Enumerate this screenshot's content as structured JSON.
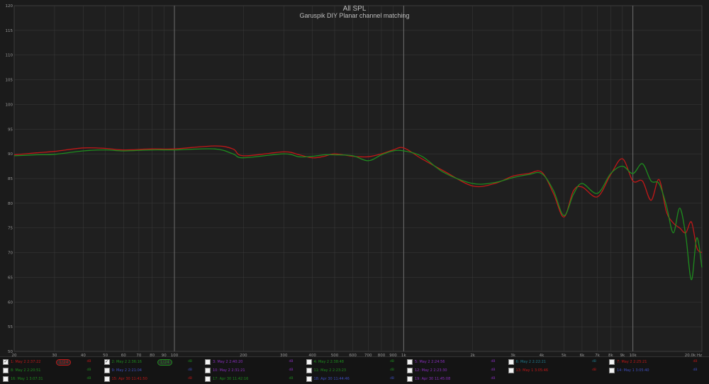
{
  "chart_data": {
    "type": "line",
    "title": "All SPL",
    "subtitle": "Garuspik DIY Planar channel matching",
    "xscale": "log",
    "xlim": [
      20,
      20000
    ],
    "ylim": [
      50,
      120
    ],
    "grid": true,
    "x_ticks": [
      {
        "v": 20,
        "t": "20"
      },
      {
        "v": 30,
        "t": "30"
      },
      {
        "v": 40,
        "t": "40"
      },
      {
        "v": 50,
        "t": "50"
      },
      {
        "v": 60,
        "t": "60"
      },
      {
        "v": 70,
        "t": "70"
      },
      {
        "v": 80,
        "t": "80"
      },
      {
        "v": 90,
        "t": "90"
      },
      {
        "v": 100,
        "t": "100"
      },
      {
        "v": 200,
        "t": "200"
      },
      {
        "v": 300,
        "t": "300"
      },
      {
        "v": 400,
        "t": "400"
      },
      {
        "v": 500,
        "t": "500"
      },
      {
        "v": 600,
        "t": "600"
      },
      {
        "v": 700,
        "t": "700"
      },
      {
        "v": 800,
        "t": "800"
      },
      {
        "v": 900,
        "t": "900"
      },
      {
        "v": 1000,
        "t": "1k"
      },
      {
        "v": 2000,
        "t": "2k"
      },
      {
        "v": 3000,
        "t": "3k"
      },
      {
        "v": 4000,
        "t": "4k"
      },
      {
        "v": 5000,
        "t": "5k"
      },
      {
        "v": 6000,
        "t": "6k"
      },
      {
        "v": 7000,
        "t": "7k"
      },
      {
        "v": 8000,
        "t": "8k"
      },
      {
        "v": 9000,
        "t": "9k"
      },
      {
        "v": 10000,
        "t": "10k"
      },
      {
        "v": 20000,
        "t": "20.0k Hz"
      }
    ],
    "y_ticks": [
      50,
      55,
      60,
      65,
      70,
      75,
      80,
      85,
      90,
      95,
      100,
      105,
      110,
      115,
      120
    ],
    "series": [
      {
        "name": "1: May 2 2:37:22",
        "color": "#c01818",
        "x": [
          20,
          25,
          30,
          40,
          50,
          60,
          80,
          100,
          150,
          180,
          200,
          300,
          350,
          400,
          450,
          500,
          600,
          700,
          800,
          900,
          1000,
          1200,
          1500,
          2000,
          2500,
          3000,
          3500,
          4000,
          4500,
          5000,
          5500,
          6000,
          7000,
          8000,
          9000,
          10000,
          11000,
          12000,
          13000,
          14000,
          15000,
          16000,
          17000,
          18000,
          19000,
          20000
        ],
        "values": [
          89.8,
          90.2,
          90.5,
          91.2,
          91.1,
          90.8,
          91.0,
          91.0,
          91.6,
          91.0,
          89.6,
          90.4,
          89.8,
          89.2,
          89.5,
          90.0,
          89.5,
          89.4,
          90.0,
          90.8,
          91.2,
          89.0,
          86.5,
          83.5,
          84.0,
          85.5,
          86.0,
          86.3,
          82.0,
          77.2,
          82.5,
          83.3,
          81.3,
          85.8,
          89.0,
          84.5,
          84.5,
          80.6,
          84.8,
          78.3,
          76.0,
          75.0,
          74.0,
          76.2,
          71.0,
          70.0
        ]
      },
      {
        "name": "2: May 2 2:36:16",
        "color": "#1e8c1e",
        "x": [
          20,
          25,
          30,
          40,
          50,
          60,
          80,
          100,
          150,
          180,
          200,
          300,
          350,
          400,
          450,
          500,
          600,
          700,
          800,
          900,
          1000,
          1200,
          1500,
          2000,
          2500,
          3000,
          3500,
          4000,
          4500,
          5000,
          5500,
          6000,
          7000,
          8000,
          9000,
          10000,
          11000,
          12000,
          13000,
          14000,
          15000,
          16000,
          17000,
          18000,
          19000,
          20000
        ],
        "values": [
          89.6,
          89.8,
          89.9,
          90.6,
          90.8,
          90.6,
          90.8,
          90.8,
          91.0,
          90.0,
          89.2,
          90.0,
          89.4,
          89.5,
          89.8,
          89.8,
          89.6,
          88.6,
          89.8,
          90.6,
          90.6,
          89.5,
          86.2,
          84.0,
          84.2,
          85.2,
          85.8,
          86.0,
          82.6,
          77.5,
          81.8,
          84.0,
          82.0,
          86.0,
          87.5,
          86.0,
          88.0,
          84.5,
          84.0,
          79.5,
          74.0,
          79.0,
          73.5,
          64.5,
          73.0,
          67.0
        ]
      }
    ]
  },
  "legend": [
    {
      "label": "1: May 2 2:37:22",
      "color": "#c01818",
      "checked": true,
      "smooth": "1/24",
      "right": "dB"
    },
    {
      "label": "2: May 2 2:36:16",
      "color": "#1e8c1e",
      "checked": true,
      "smooth": "1/24",
      "right": "dB"
    },
    {
      "label": "3: May 2 2:40:20",
      "color": "#8a2fbf",
      "checked": false,
      "smooth": "",
      "right": "dB"
    },
    {
      "label": "4: May 2 2:38:48",
      "color": "#1e8c1e",
      "checked": false,
      "smooth": "",
      "right": "dB"
    },
    {
      "label": "5: May 2 2:24:56",
      "color": "#8a2fbf",
      "checked": false,
      "smooth": "",
      "right": "dB"
    },
    {
      "label": "6: May 2 2:22:21",
      "color": "#1f7a8c",
      "checked": false,
      "smooth": "",
      "right": "dB"
    },
    {
      "label": "7: May 2 2:25:21",
      "color": "#c01818",
      "checked": false,
      "smooth": "",
      "right": "dB"
    },
    {
      "label": "8: May 2 2:20:51",
      "color": "#1e8c1e",
      "checked": false,
      "smooth": "",
      "right": "dB"
    },
    {
      "label": "9: May 2 2:21:04",
      "color": "#3f4fbf",
      "checked": false,
      "smooth": "",
      "right": "dB"
    },
    {
      "label": "10: May 2 2:31:21",
      "color": "#8a2fbf",
      "checked": false,
      "smooth": "",
      "right": "dB"
    },
    {
      "label": "11: May 2 2:23:23",
      "color": "#1e8c1e",
      "checked": false,
      "smooth": "",
      "right": "dB"
    },
    {
      "label": "12: May 2 2:23:30",
      "color": "#8a2fbf",
      "checked": false,
      "smooth": "",
      "right": "dB"
    },
    {
      "label": "13: May 1 3:05:46",
      "color": "#c01818",
      "checked": false,
      "smooth": "",
      "right": "dB"
    },
    {
      "label": "14: May 1 3:05:40",
      "color": "#3f4fbf",
      "checked": false,
      "smooth": "",
      "right": "dB"
    },
    {
      "label": "16: May 1 3:07:31",
      "color": "#1e8c1e",
      "checked": false,
      "smooth": "",
      "right": "dB"
    },
    {
      "label": "15: Apr 30 11:41:50",
      "color": "#c01818",
      "checked": false,
      "smooth": "",
      "right": "dB"
    },
    {
      "label": "17: Apr 30 11:42:16",
      "color": "#1e8c1e",
      "checked": false,
      "smooth": "",
      "right": "dB"
    },
    {
      "label": "18: Apr 30 11:44:46",
      "color": "#3f4fbf",
      "checked": false,
      "smooth": "",
      "right": "dB"
    },
    {
      "label": "19: Apr 30 11:45:08",
      "color": "#8a2fbf",
      "checked": false,
      "smooth": "",
      "right": "dB"
    }
  ]
}
